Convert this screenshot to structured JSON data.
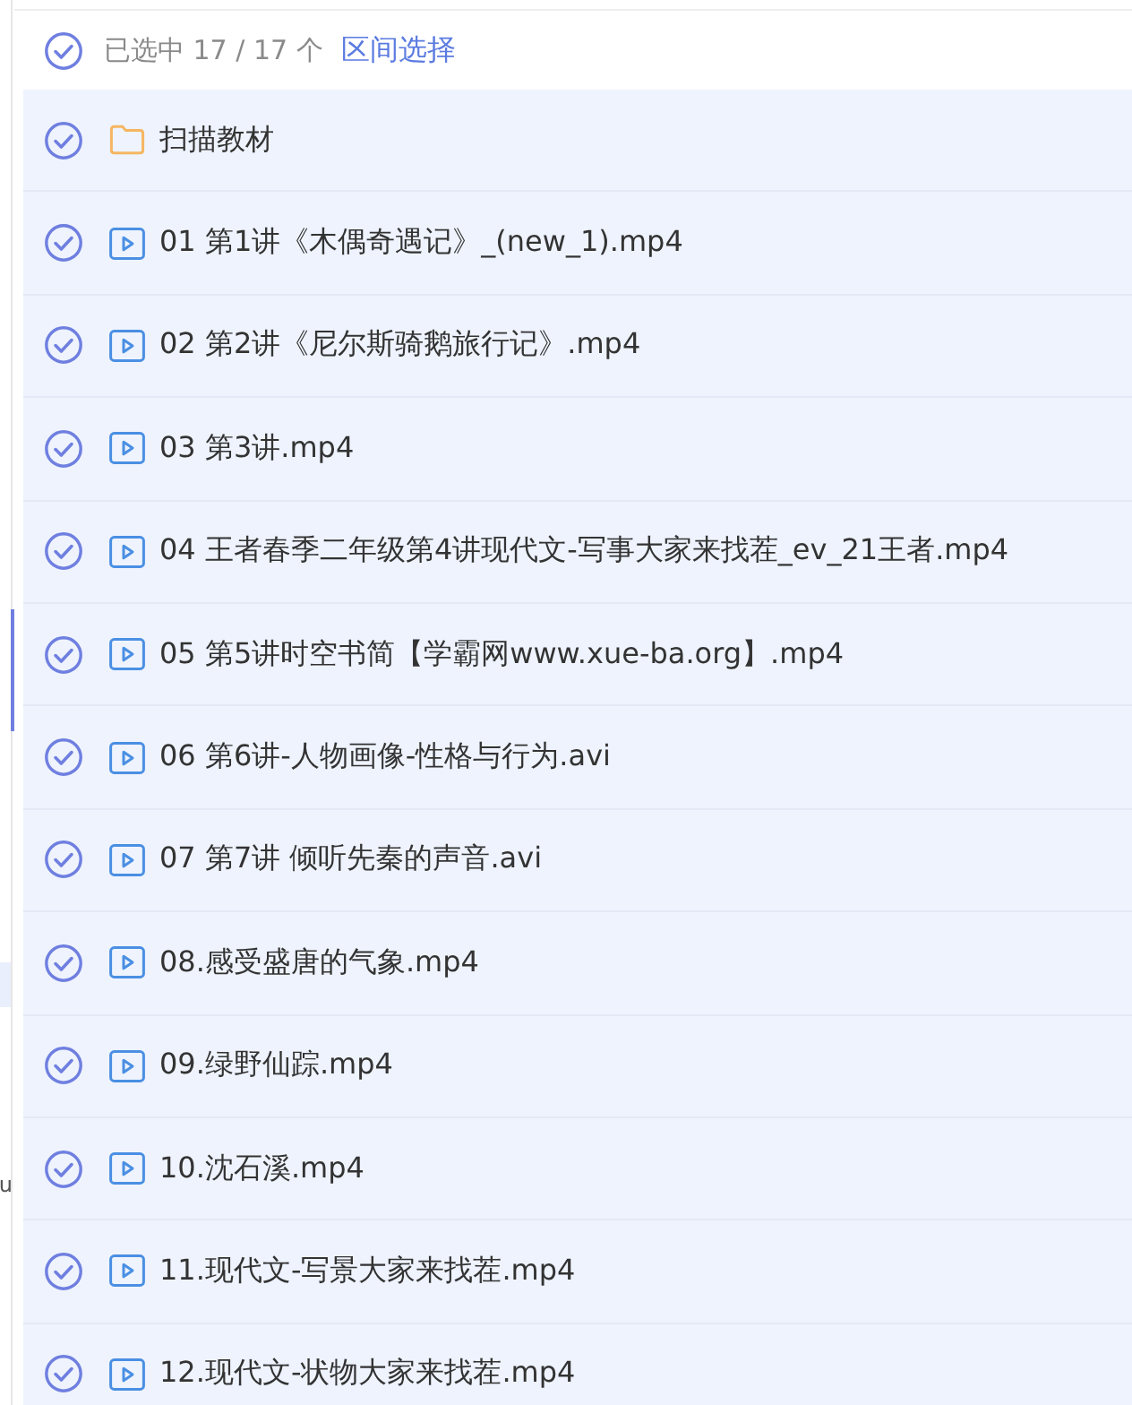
{
  "sidebar": {
    "items": [
      {
        "selected": true
      },
      {
        "label": "u",
        "selected": false
      }
    ]
  },
  "header": {
    "checked": true,
    "selection_count": "已选中 17 / 17 个",
    "range_select_link": "区间选择"
  },
  "files": [
    {
      "kind": "folder",
      "name": "扫描教材",
      "checked": true
    },
    {
      "kind": "video",
      "name": "01 第1讲《木偶奇遇记》_(new_1).mp4",
      "checked": true
    },
    {
      "kind": "video",
      "name": "02 第2讲《尼尔斯骑鹅旅行记》.mp4",
      "checked": true
    },
    {
      "kind": "video",
      "name": "03 第3讲.mp4",
      "checked": true
    },
    {
      "kind": "video",
      "name": "04 王者春季二年级第4讲现代文-写事大家来找茬_ev_21王者.mp4",
      "checked": true
    },
    {
      "kind": "video",
      "name": "05 第5讲时空书简【学霸网www.xue-ba.org】.mp4",
      "checked": true
    },
    {
      "kind": "video",
      "name": "06 第6讲-人物画像-性格与行为.avi",
      "checked": true
    },
    {
      "kind": "video",
      "name": "07 第7讲 倾听先秦的声音.avi",
      "checked": true
    },
    {
      "kind": "video",
      "name": "08.感受盛唐的气象.mp4",
      "checked": true
    },
    {
      "kind": "video",
      "name": "09.绿野仙踪.mp4",
      "checked": true
    },
    {
      "kind": "video",
      "name": "10.沈石溪.mp4",
      "checked": true
    },
    {
      "kind": "video",
      "name": "11.现代文-写景大家来找茬.mp4",
      "checked": true
    },
    {
      "kind": "video",
      "name": "12.现代文-状物大家来找茬.mp4",
      "checked": true
    }
  ]
}
